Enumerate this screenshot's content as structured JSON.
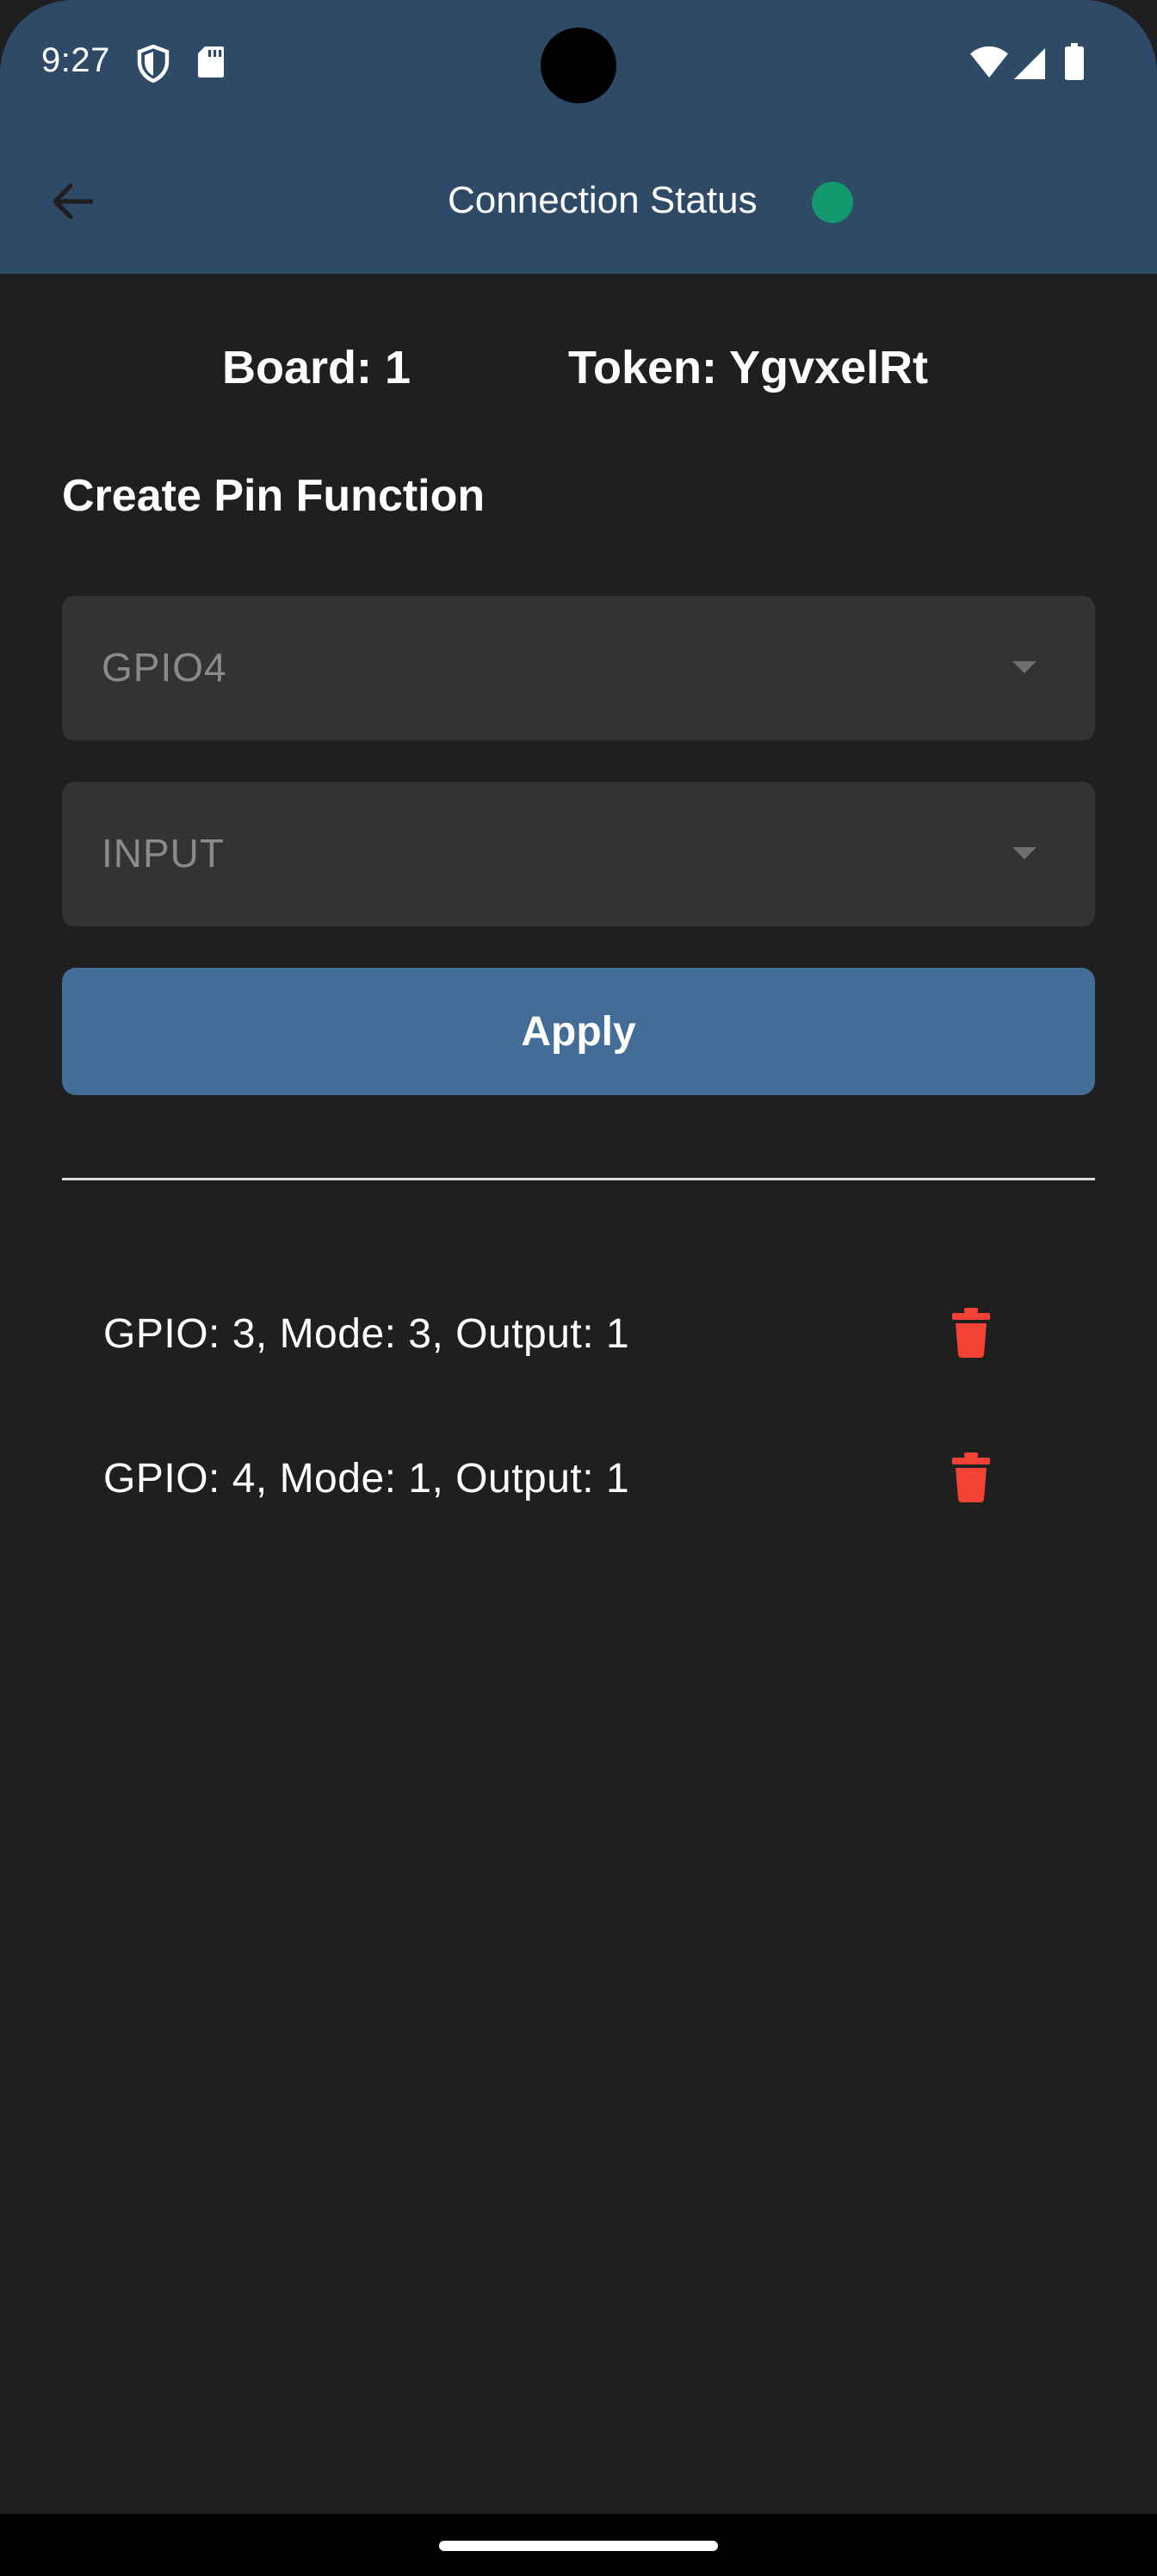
{
  "status_bar": {
    "time": "9:27",
    "icons": [
      "shield-icon",
      "sd-card-icon",
      "wifi-icon",
      "signal-icon",
      "battery-icon"
    ]
  },
  "app_bar": {
    "back_icon": "arrow-back-icon",
    "title": "Connection Status",
    "status_color": "#129a6e",
    "background": "#2f4a67"
  },
  "board": {
    "board_label": "Board: 1",
    "token_label": "Token: YgvxelRt"
  },
  "create_section": {
    "title": "Create Pin Function",
    "pin_dropdown": {
      "value": "GPIO4",
      "icon": "dropdown-caret-icon"
    },
    "mode_dropdown": {
      "value": "INPUT",
      "icon": "dropdown-caret-icon"
    },
    "apply_label": "Apply",
    "apply_color": "#436d97"
  },
  "pins": [
    {
      "label": "GPIO: 3, Mode: 3, Output: 1",
      "icon": "trash-icon",
      "icon_color": "#f44336"
    },
    {
      "label": "GPIO: 4, Mode: 1, Output: 1",
      "icon": "trash-icon",
      "icon_color": "#f44336"
    }
  ]
}
